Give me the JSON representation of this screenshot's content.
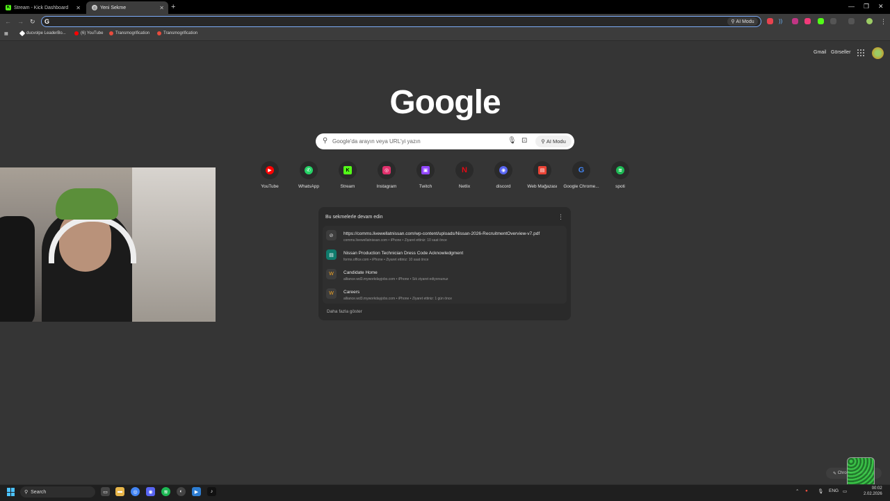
{
  "tabs": [
    {
      "title": "Stream - Kick Dashboard",
      "icon": "kick-icon",
      "color": "#53fc18"
    },
    {
      "title": "Yeni Sekme",
      "icon": "chrome-icon",
      "color": "#cfcfcf"
    }
  ],
  "toolbar": {
    "omnibox_value": "",
    "ai_mode_label": "AI Modu"
  },
  "bookmarks": [
    {
      "label": "ducvolpe LeaderBo...",
      "color": "#ffffff"
    },
    {
      "label": "(6) YouTube",
      "color": "#ff0000"
    },
    {
      "label": "Transmogrification",
      "color": "#e84c3d"
    },
    {
      "label": "Transmogrification",
      "color": "#e84c3d"
    }
  ],
  "header": {
    "gmail": "Gmail",
    "images": "Görseller"
  },
  "logo": "Google",
  "search": {
    "placeholder": "Google'da arayın veya URL'yi yazın",
    "ai_mode": "AI Modu"
  },
  "shortcuts": [
    {
      "label": "YouTube",
      "icon": "youtube-icon",
      "color": "#ff0000",
      "glyph": "▶"
    },
    {
      "label": "WhatsApp",
      "icon": "whatsapp-icon",
      "color": "#25d366",
      "glyph": "✆"
    },
    {
      "label": "Stream",
      "icon": "kick-icon",
      "color": "#53fc18",
      "glyph": "K"
    },
    {
      "label": "Instagram",
      "icon": "instagram-icon",
      "color": "#e1306c",
      "glyph": "◎"
    },
    {
      "label": "Twitch",
      "icon": "twitch-icon",
      "color": "#9146ff",
      "glyph": "▣"
    },
    {
      "label": "Netlix",
      "icon": "netflix-icon",
      "color": "#e50914",
      "glyph": "N"
    },
    {
      "label": "discord",
      "icon": "discord-icon",
      "color": "#5865f2",
      "glyph": "◉"
    },
    {
      "label": "Web Mağazası",
      "icon": "web-store-icon",
      "color": "#ea4335",
      "glyph": "▤"
    },
    {
      "label": "Google Chrome...",
      "icon": "google-icon",
      "color": "#4285f4",
      "glyph": "G"
    },
    {
      "label": "spoti",
      "icon": "spotify-icon",
      "color": "#1db954",
      "glyph": "≋"
    }
  ],
  "continue_card": {
    "title": "Bu sekmelerle devam edin",
    "show_more": "Daha fazla göster",
    "items": [
      {
        "title": "https://comms.livewellatnissan.com/wp-content/uploads/Nissan-2026-RecruitmentOverview-v7.pdf",
        "subtitle": "comms.livewellatnissan.com • iPhone • Ziyaret ettiniz: 10 saat önce",
        "icon": "globe-icon"
      },
      {
        "title": "Nissan Production Technician Dress Code Acknowledgment",
        "subtitle": "forms.office.com • iPhone • Ziyaret ettiniz: 10 saat önce",
        "icon": "forms-icon"
      },
      {
        "title": "Candidate Home",
        "subtitle": "alliance.wd3.myworkdayjobs.com • iPhone • Sık ziyaret ediyorsunuz",
        "icon": "workday-icon"
      },
      {
        "title": "Careers",
        "subtitle": "alliance.wd3.myworkdayjobs.com • iPhone • Ziyaret ettiniz: 1 gün önce",
        "icon": "workday-icon"
      }
    ]
  },
  "customize_label": "Chrome'u özelleştir",
  "taskbar": {
    "search_label": "Search",
    "lang": "ENG",
    "time": "00:02",
    "date": "2.02.2026"
  }
}
